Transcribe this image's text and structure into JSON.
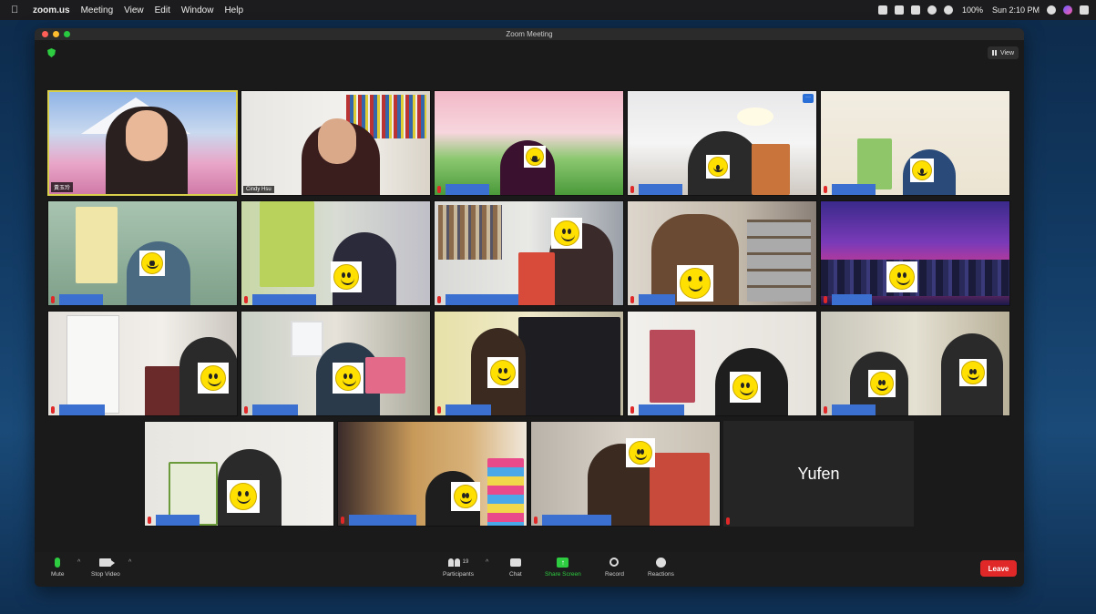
{
  "menubar": {
    "app": "zoom.us",
    "items": [
      "Meeting",
      "View",
      "Edit",
      "Window",
      "Help"
    ],
    "battery": "100%",
    "clock": "Sun 2:10 PM"
  },
  "window": {
    "title": "Zoom Meeting",
    "view_label": "View"
  },
  "participants": {
    "tag_1": "黃玉玲",
    "tag_2": "Cindy Hsu",
    "name_only": "Yufen"
  },
  "controls": {
    "mute": "Mute",
    "stop_video": "Stop Video",
    "participants": "Participants",
    "participants_count": "19",
    "chat": "Chat",
    "share_screen": "Share Screen",
    "record": "Record",
    "reactions": "Reactions",
    "leave": "Leave"
  },
  "colors": {
    "accent_green": "#2ecc40",
    "leave_red": "#e02828",
    "active_border": "#d8cf4a",
    "name_bar_blue": "#3b6fd0"
  }
}
